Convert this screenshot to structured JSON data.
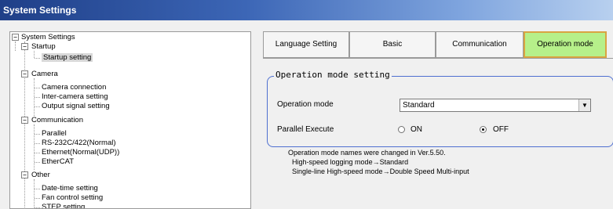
{
  "window": {
    "title": "System Settings"
  },
  "tree": {
    "root": "System Settings",
    "startup": {
      "label": "Startup",
      "children": [
        "Startup setting"
      ]
    },
    "camera": {
      "label": "Camera",
      "children": [
        "Camera connection",
        "Inter-camera setting",
        "Output signal setting"
      ]
    },
    "communication": {
      "label": "Communication",
      "children": [
        "Parallel",
        "RS-232C/422(Normal)",
        "Ethernet(Normal(UDP))",
        "EtherCAT"
      ]
    },
    "other": {
      "label": "Other",
      "children": [
        "Date-time setting",
        "Fan control setting",
        "STEP setting"
      ]
    },
    "expander_symbol": "−"
  },
  "tabs": [
    {
      "label": "Language Setting"
    },
    {
      "label": "Basic"
    },
    {
      "label": "Communication"
    },
    {
      "label": "Operation mode",
      "active": true
    }
  ],
  "group": {
    "title": "Operation mode setting",
    "operation_mode_label": "Operation mode",
    "operation_mode_value": "Standard",
    "dropdown_arrow": "▼",
    "parallel_label": "Parallel Execute",
    "radio_on": "ON",
    "radio_off": "OFF",
    "selected": "OFF"
  },
  "notes": [
    "Operation mode names were changed in Ver.5.50.",
    "High-speed logging mode→Standard",
    "Single-line High-speed mode→Double Speed Multi-input"
  ],
  "colors": {
    "active_tab": "#b6f08a",
    "active_tab_border": "#d9a441",
    "group_border": "#4e6fd0"
  }
}
